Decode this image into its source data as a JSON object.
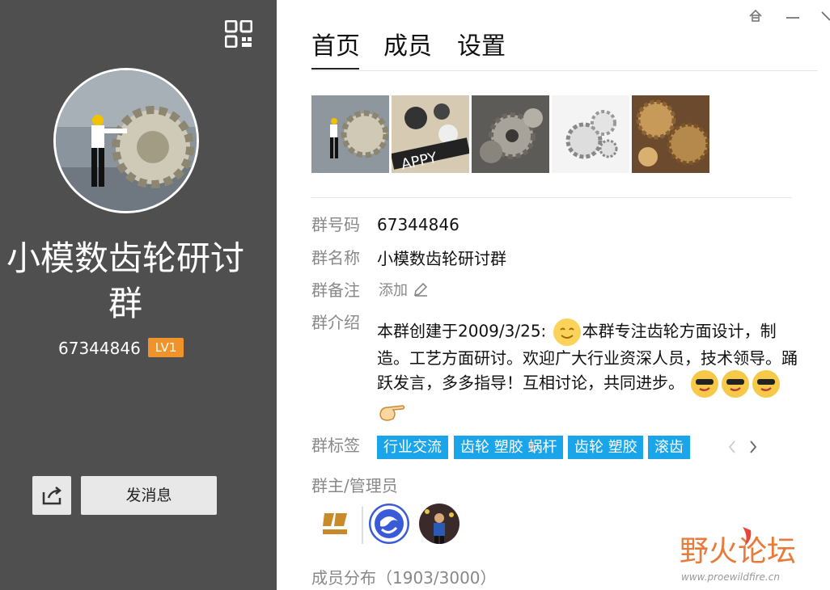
{
  "window": {
    "pin_icon": "pin-icon",
    "minimize_icon": "minimize-icon",
    "close_icon": "close-icon"
  },
  "left": {
    "group_name": "小模数齿轮研讨群",
    "group_number": "67344846",
    "level_badge": "LV1",
    "send_message_label": "发消息",
    "share_icon": "share-icon",
    "qr_icon": "qr-code-icon"
  },
  "tabs": [
    {
      "label": "首页",
      "active": true
    },
    {
      "label": "成员",
      "active": false
    },
    {
      "label": "设置",
      "active": false
    }
  ],
  "info": {
    "group_number_label": "群号码",
    "group_number_value": "67344846",
    "group_name_label": "群名称",
    "group_name_value": "小模数齿轮研讨群",
    "remark_label": "群备注",
    "remark_add": "添加",
    "intro_label": "群介绍",
    "intro_text_1": "本群创建于2009/3/25: ",
    "intro_text_2": "本群专注齿轮方面设计，制造。工艺方面研讨。欢迎广大行业资深人员，技术领导。踊跃发言，多多指导！互相讨论，共同进步。",
    "tags_label": "群标签",
    "tags": [
      "行业交流",
      "齿轮 塑胶 蜗杆",
      "齿轮 塑胶",
      "滚齿"
    ],
    "admins_label": "群主/管理员",
    "members_label": "成员分布（1903/3000）"
  },
  "watermark": {
    "text": "野火论坛",
    "url": "www.proewildfire.cn"
  },
  "colors": {
    "left_bg": "#4f4f4f",
    "tag_bg": "#1aa4ea",
    "badge_bg": "#f0932b"
  }
}
